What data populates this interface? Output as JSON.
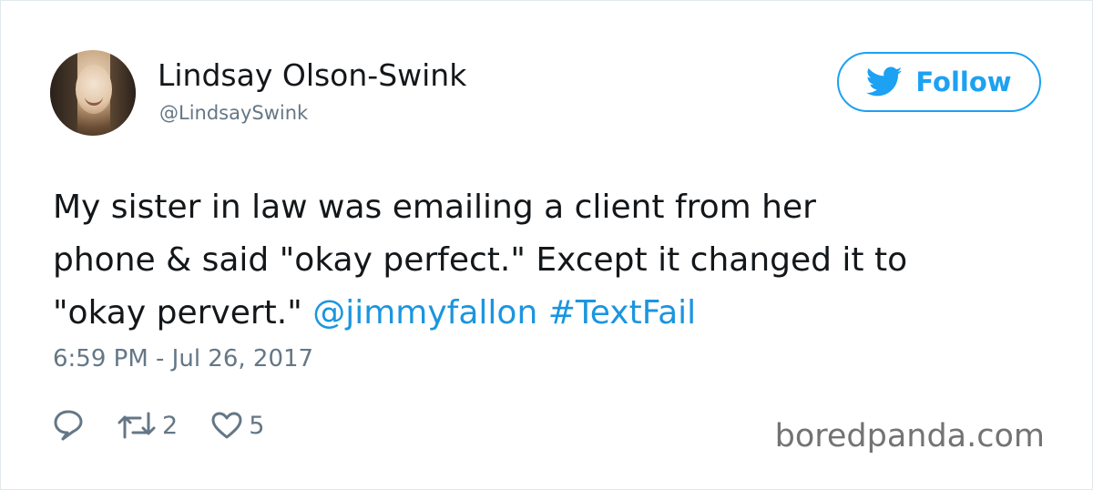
{
  "author": {
    "display_name": "Lindsay Olson-Swink",
    "handle": "@LindsaySwink"
  },
  "follow_button": {
    "label": "Follow",
    "icon": "twitter-bird-icon",
    "color": "#1da1f2"
  },
  "tweet": {
    "line1": "My sister in law was emailing a client from her",
    "line2": "phone & said \"okay perfect.\" Except it changed it to",
    "line3_text": "\"okay pervert.\" ",
    "mention": "@jimmyfallon",
    "hashtag": "#TextFail",
    "timestamp": "6:59 PM - Jul 26, 2017"
  },
  "actions": {
    "reply_icon": "reply-icon",
    "retweet_icon": "retweet-icon",
    "retweet_count": "2",
    "like_icon": "heart-icon",
    "like_count": "5"
  },
  "watermark": "boredpanda.com",
  "colors": {
    "link": "#1b95e0",
    "muted": "#657786",
    "text": "#14171a"
  }
}
